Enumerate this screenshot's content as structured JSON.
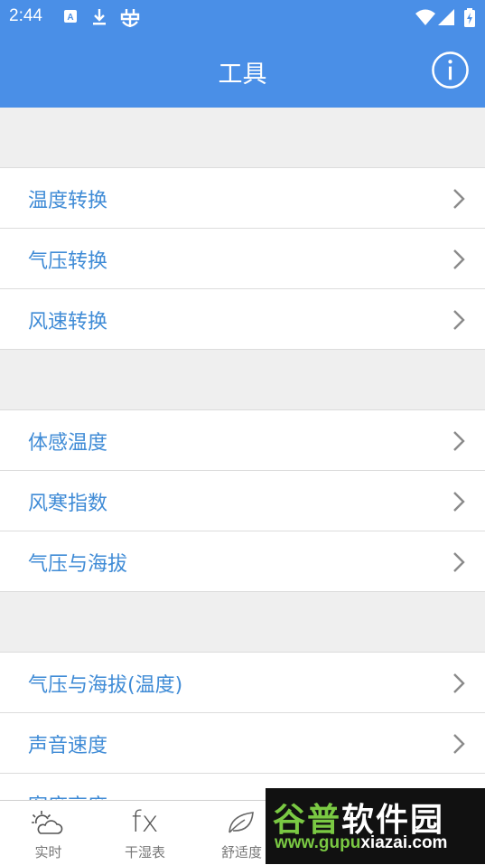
{
  "status": {
    "time": "2:44"
  },
  "appbar": {
    "title": "工具"
  },
  "groups": [
    {
      "items": [
        {
          "label": "温度转换"
        },
        {
          "label": "气压转换"
        },
        {
          "label": "风速转换"
        }
      ]
    },
    {
      "items": [
        {
          "label": "体感温度"
        },
        {
          "label": "风寒指数"
        },
        {
          "label": "气压与海拔"
        }
      ]
    },
    {
      "items": [
        {
          "label": "气压与海拔(温度)"
        },
        {
          "label": "声音速度"
        },
        {
          "label": "密度高度"
        }
      ]
    }
  ],
  "tabs": [
    {
      "label": "实时",
      "icon": "weather-sun-cloud-icon"
    },
    {
      "label": "干湿表",
      "icon": "fx-icon",
      "glyph": "fx"
    },
    {
      "label": "舒适度",
      "icon": "leaf-icon"
    }
  ],
  "watermark": {
    "brand_a": "谷普",
    "brand_b": "软件园",
    "url_a": "www.gupu",
    "url_b": "xiazai.com"
  },
  "colors": {
    "primary": "#4a8fe7",
    "item_text": "#3f8bd6",
    "watermark_green": "#7ac943"
  }
}
